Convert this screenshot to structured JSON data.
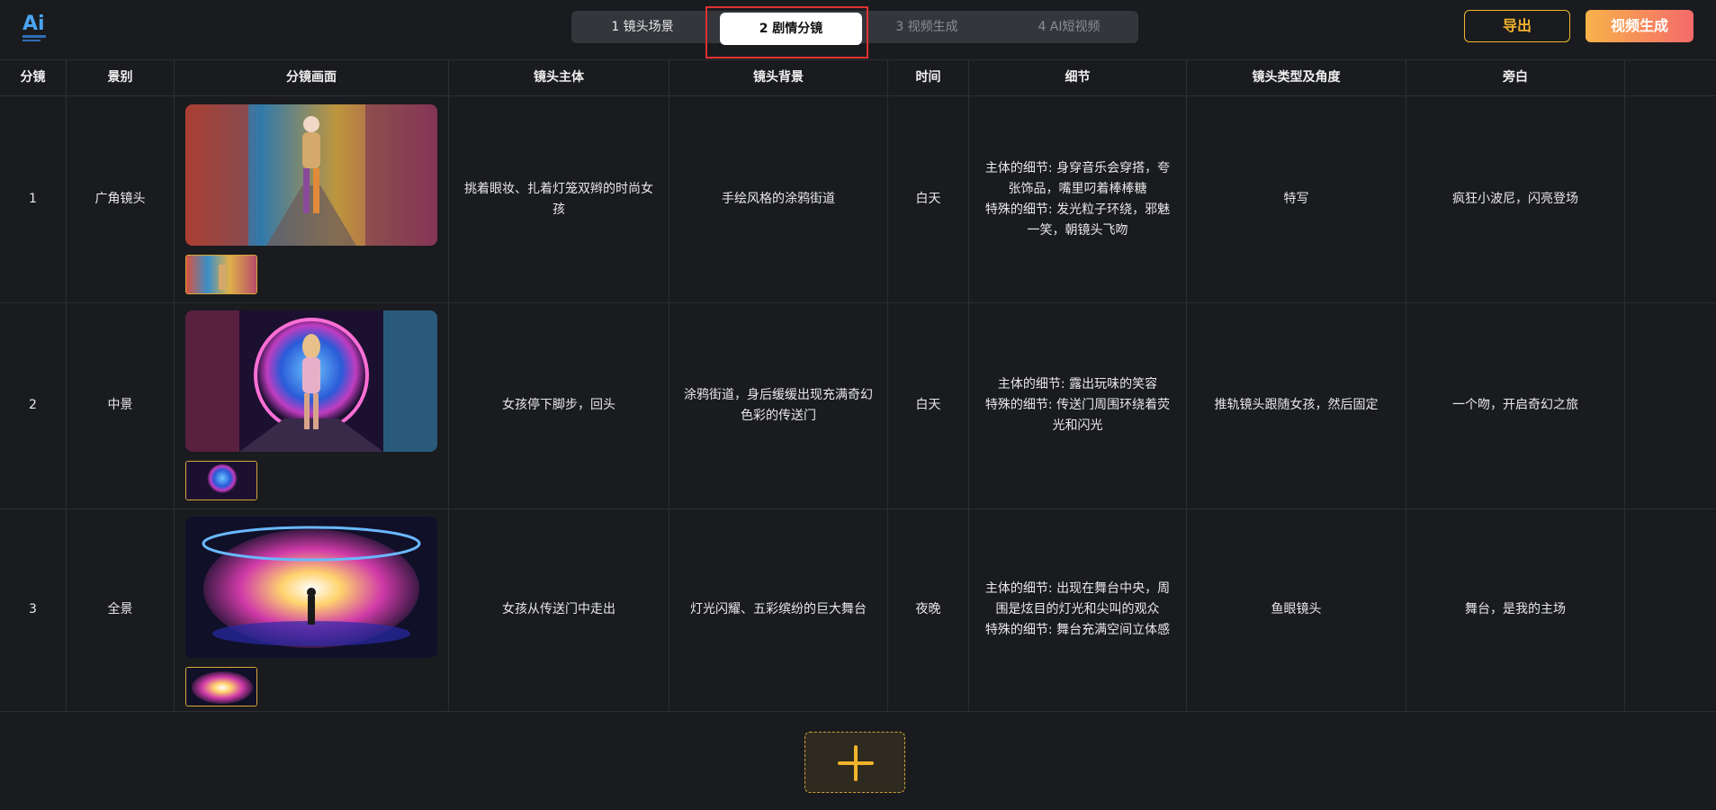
{
  "header": {
    "logo_text": "Ai",
    "tabs": [
      {
        "label": "1 镜头场景"
      },
      {
        "label": "2 剧情分镜"
      },
      {
        "label": "3 视频生成"
      },
      {
        "label": "4 AI短视频"
      }
    ],
    "active_tab": "2 剧情分镜",
    "export_label": "导出",
    "generate_label": "视频生成"
  },
  "table": {
    "columns": [
      "分镜",
      "景别",
      "分镜画面",
      "镜头主体",
      "镜头背景",
      "时间",
      "细节",
      "镜头类型及角度",
      "旁白",
      ""
    ],
    "rows": [
      {
        "index": "1",
        "shot_size": "广角镜头",
        "subject": "挑着眼妆、扎着灯笼双辫的时尚女孩",
        "background": "手绘风格的涂鸦街道",
        "time": "白天",
        "detail": "主体的细节: 身穿音乐会穿搭，夸张饰品，嘴里叼着棒棒糖\n特殊的细节: 发光粒子环绕，邪魅一笑，朝镜头飞吻",
        "camera": "特写",
        "narration": "疯狂小波尼，闪亮登场"
      },
      {
        "index": "2",
        "shot_size": "中景",
        "subject": "女孩停下脚步，回头",
        "background": "涂鸦街道，身后缓缓出现充满奇幻色彩的传送门",
        "time": "白天",
        "detail": "主体的细节: 露出玩味的笑容\n特殊的细节: 传送门周围环绕着荧光和闪光",
        "camera": "推轨镜头跟随女孩，然后固定",
        "narration": "一个吻，开启奇幻之旅"
      },
      {
        "index": "3",
        "shot_size": "全景",
        "subject": "女孩从传送门中走出",
        "background": "灯光闪耀、五彩缤纷的巨大舞台",
        "time": "夜晚",
        "detail": "主体的细节: 出现在舞台中央，周围是炫目的灯光和尖叫的观众\n特殊的细节: 舞台充满空间立体感",
        "camera": "鱼眼镜头",
        "narration": "舞台，是我的主场"
      }
    ]
  },
  "colors": {
    "accent": "#f2b42c",
    "background": "#1a1b1f",
    "highlight_box": "#e03232"
  }
}
